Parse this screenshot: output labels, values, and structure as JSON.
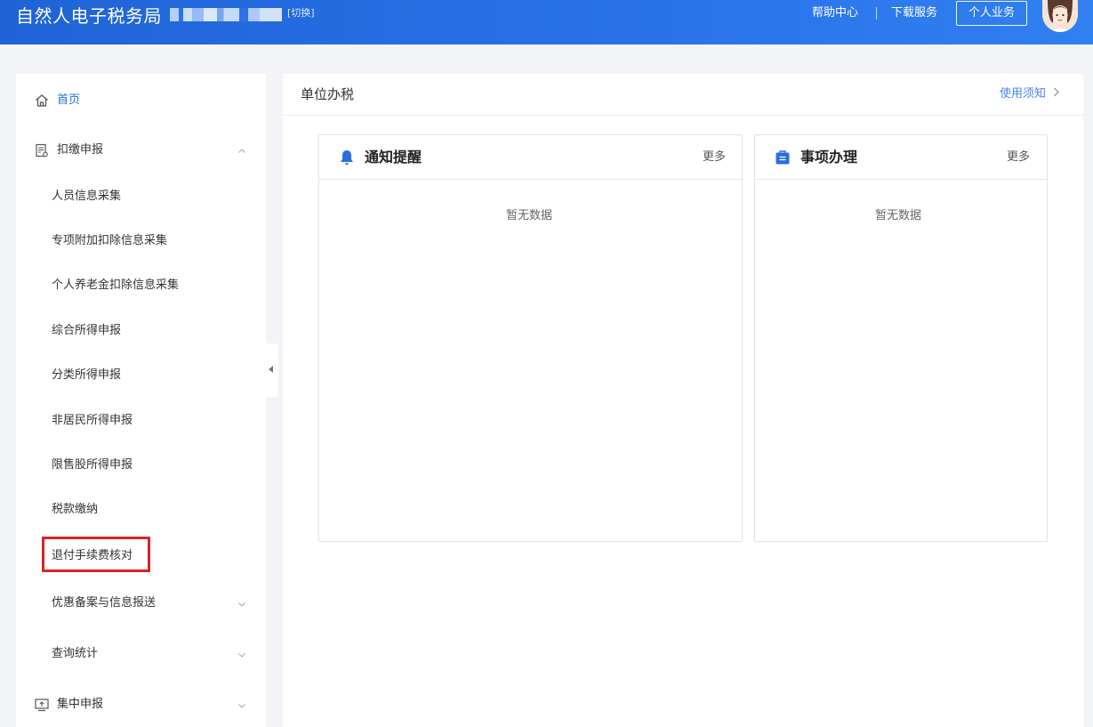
{
  "header": {
    "app_title": "自然人电子税务局",
    "switch_label": "[切换]",
    "help_center": "帮助中心",
    "download_service": "下载服务",
    "personal_business": "个人业务"
  },
  "sidebar": {
    "home": "首页",
    "withholding": {
      "label": "扣缴申报",
      "items": [
        "人员信息采集",
        "专项附加扣除信息采集",
        "个人养老金扣除信息采集",
        "综合所得申报",
        "分类所得申报",
        "非居民所得申报",
        "限售股所得申报",
        "税款缴纳",
        "退付手续费核对"
      ]
    },
    "preferential_filing": "优惠备案与信息报送",
    "query_stats": "查询统计",
    "centralized_filing": "集中申报"
  },
  "main": {
    "title": "单位办税",
    "usage_notice": "使用须知",
    "cards": [
      {
        "title": "通知提醒",
        "more": "更多",
        "empty": "暂无数据",
        "icon": "bell-icon"
      },
      {
        "title": "事项办理",
        "more": "更多",
        "empty": "暂无数据",
        "icon": "briefcase-icon"
      }
    ]
  },
  "colors": {
    "header_blue": "#2a72ea",
    "accent_blue": "#2a6fe0",
    "highlight_red": "#d9242a"
  }
}
